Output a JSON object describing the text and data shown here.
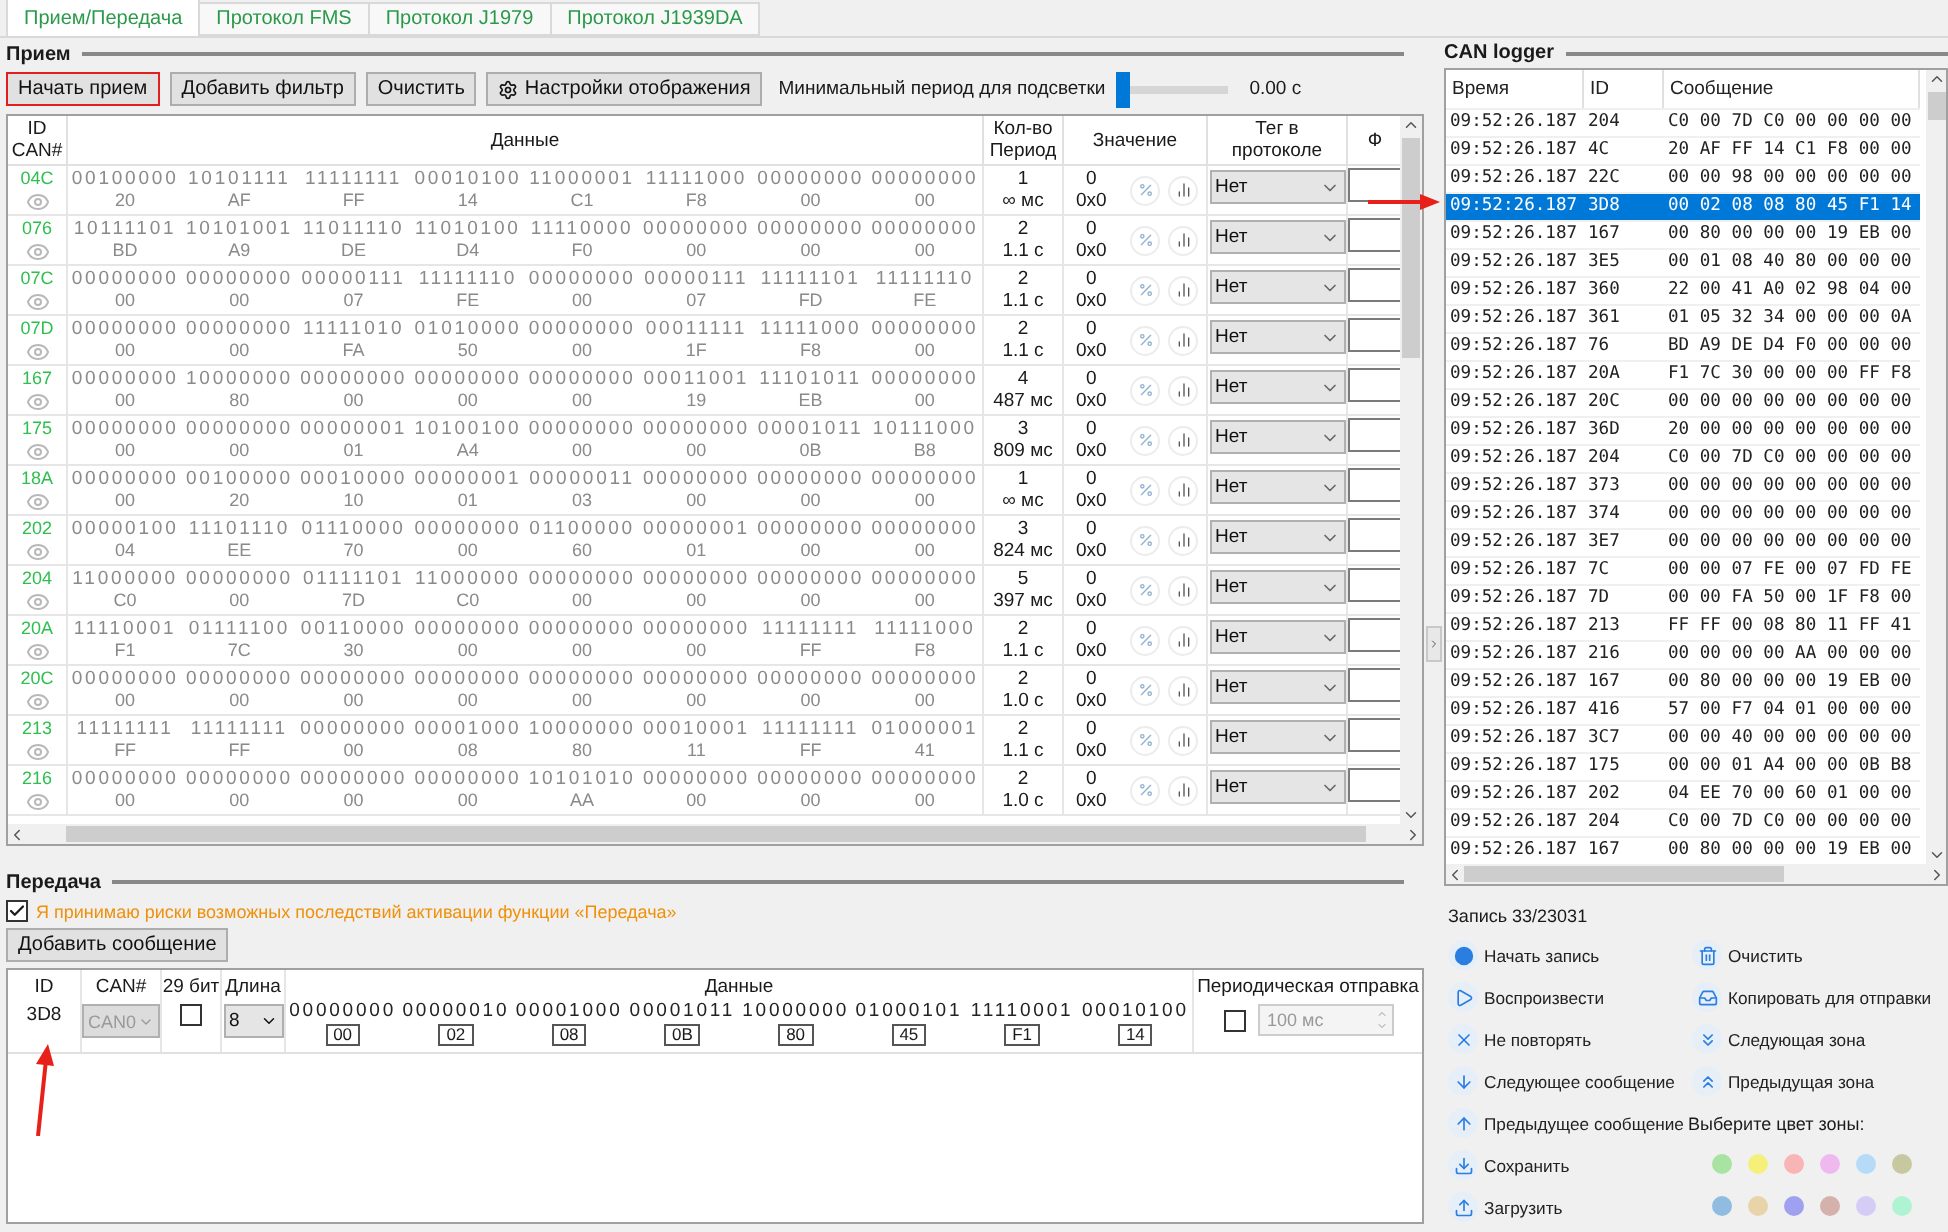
{
  "tabs": [
    {
      "label": "Прием/Передача",
      "selected": true
    },
    {
      "label": "Протокол FMS",
      "selected": false
    },
    {
      "label": "Протокол J1979",
      "selected": false
    },
    {
      "label": "Протокол J1939DA",
      "selected": false
    }
  ],
  "receive": {
    "title": "Прием",
    "toolbar": [
      {
        "label": "Начать прием",
        "highlighted": true,
        "kind": "plain"
      },
      {
        "label": "Добавить фильтр",
        "highlighted": false,
        "kind": "plain"
      },
      {
        "label": "Очистить",
        "highlighted": false,
        "kind": "plain"
      },
      {
        "label": "Настройки отображения",
        "highlighted": false,
        "kind": "settings"
      }
    ],
    "slider": {
      "label": "Минимальный период для подсветки",
      "level": 0,
      "reading": "0.00 с"
    },
    "columns": [
      "ID CAN#",
      "Данные",
      "Кол-во Период",
      "Значение",
      "Тег в протоколе",
      "Ф"
    ],
    "rows": [
      {
        "id": "04C",
        "bits": "00100000 10101111 11111111 00010100 11000001 11111000 00000000 00000000",
        "hex": "20 AF FF 14 C1 F8 00 00",
        "count": "1",
        "period": "∞ мс",
        "dec": "0",
        "hexval": "0x0",
        "tag": "Нет"
      },
      {
        "id": "076",
        "bits": "10111101 10101001 11011110 11010100 11110000 00000000 00000000 00000000",
        "hex": "BD A9 DE D4 F0 00 00 00",
        "count": "2",
        "period": "1.1 с",
        "dec": "0",
        "hexval": "0x0",
        "tag": "Нет"
      },
      {
        "id": "07C",
        "bits": "00000000 00000000 00000111 11111110 00000000 00000111 11111101 11111110",
        "hex": "00 00 07 FE 00 07 FD FE",
        "count": "2",
        "period": "1.1 с",
        "dec": "0",
        "hexval": "0x0",
        "tag": "Нет"
      },
      {
        "id": "07D",
        "bits": "00000000 00000000 11111010 01010000 00000000 00011111 11111000 00000000",
        "hex": "00 00 FA 50 00 1F F8 00",
        "count": "2",
        "period": "1.1 с",
        "dec": "0",
        "hexval": "0x0",
        "tag": "Нет"
      },
      {
        "id": "167",
        "bits": "00000000 10000000 00000000 00000000 00000000 00011001 11101011 00000000",
        "hex": "00 80 00 00 00 19 EB 00",
        "count": "4",
        "period": "487 мс",
        "dec": "0",
        "hexval": "0x0",
        "tag": "Нет"
      },
      {
        "id": "175",
        "bits": "00000000 00000000 00000001 10100100 00000000 00000000 00001011 10111000",
        "hex": "00 00 01 A4 00 00 0B B8",
        "count": "3",
        "period": "809 мс",
        "dec": "0",
        "hexval": "0x0",
        "tag": "Нет"
      },
      {
        "id": "18A",
        "bits": "00000000 00100000 00010000 00000001 00000011 00000000 00000000 00000000",
        "hex": "00 20 10 01 03 00 00 00",
        "count": "1",
        "period": "∞ мс",
        "dec": "0",
        "hexval": "0x0",
        "tag": "Нет"
      },
      {
        "id": "202",
        "bits": "00000100 11101110 01110000 00000000 01100000 00000001 00000000 00000000",
        "hex": "04 EE 70 00 60 01 00 00",
        "count": "3",
        "period": "824 мс",
        "dec": "0",
        "hexval": "0x0",
        "tag": "Нет"
      },
      {
        "id": "204",
        "bits": "11000000 00000000 01111101 11000000 00000000 00000000 00000000 00000000",
        "hex": "C0 00 7D C0 00 00 00 00",
        "count": "5",
        "period": "397 мс",
        "dec": "0",
        "hexval": "0x0",
        "tag": "Нет"
      },
      {
        "id": "20A",
        "bits": "11110001 01111100 00110000 00000000 00000000 00000000 11111111 11111000",
        "hex": "F1 7C 30 00 00 00 FF F8",
        "count": "2",
        "period": "1.1 с",
        "dec": "0",
        "hexval": "0x0",
        "tag": "Нет"
      },
      {
        "id": "20C",
        "bits": "00000000 00000000 00000000 00000000 00000000 00000000 00000000 00000000",
        "hex": "00 00 00 00 00 00 00 00",
        "count": "2",
        "period": "1.0 с",
        "dec": "0",
        "hexval": "0x0",
        "tag": "Нет"
      },
      {
        "id": "213",
        "bits": "11111111 11111111 00000000 00001000 10000000 00010001 11111111 01000001",
        "hex": "FF FF 00 08 80 11 FF 41",
        "count": "2",
        "period": "1.1 с",
        "dec": "0",
        "hexval": "0x0",
        "tag": "Нет"
      },
      {
        "id": "216",
        "bits": "00000000 00000000 00000000 00000000 10101010 00000000 00000000 00000000",
        "hex": "00 00 00 00 AA 00 00 00",
        "count": "2",
        "period": "1.0 с",
        "dec": "0",
        "hexval": "0x0",
        "tag": "Нет"
      }
    ]
  },
  "transmit": {
    "title": "Передача",
    "consent": {
      "label": "Я принимаю риски возможных последствий активации функции «Передача»",
      "checked": true
    },
    "add_button": "Добавить сообщение",
    "columns": [
      "ID",
      "CAN#",
      "29 бит",
      "Длина",
      "Данные",
      "Периодическая отправка"
    ],
    "row": {
      "id": "3D8",
      "can": {
        "value": "CAN0",
        "disabled": true
      },
      "ext29": {
        "checked": false
      },
      "length": "8",
      "bits": "00000000 00000010 00001000 00001011 10000000 01000101 11110001 00010100",
      "hex": "00 02 08 0B 80 45 F1 14",
      "periodic": {
        "checked": false
      },
      "interval": {
        "value": "100 мс",
        "disabled": true
      }
    }
  },
  "logger": {
    "title": "CAN logger",
    "columns": [
      "Время",
      "ID",
      "Сообщение"
    ],
    "rows": [
      {
        "time": "09:52:26.187",
        "id": "204",
        "msg": "C0 00 7D C0 00 00 00 00",
        "selected": false
      },
      {
        "time": "09:52:26.187",
        "id": "4C",
        "msg": "20 AF FF 14 C1 F8 00 00",
        "selected": false
      },
      {
        "time": "09:52:26.187",
        "id": "22C",
        "msg": "00 00 98 00 00 00 00 00",
        "selected": false
      },
      {
        "time": "09:52:26.187",
        "id": "3D8",
        "msg": "00 02 08 08 80 45 F1 14",
        "selected": true
      },
      {
        "time": "09:52:26.187",
        "id": "167",
        "msg": "00 80 00 00 00 19 EB 00",
        "selected": false
      },
      {
        "time": "09:52:26.187",
        "id": "3E5",
        "msg": "00 01 08 40 80 00 00 00",
        "selected": false
      },
      {
        "time": "09:52:26.187",
        "id": "360",
        "msg": "22 00 41 A0 02 98 04 00",
        "selected": false
      },
      {
        "time": "09:52:26.187",
        "id": "361",
        "msg": "01 05 32 34 00 00 00 0A",
        "selected": false
      },
      {
        "time": "09:52:26.187",
        "id": "76",
        "msg": "BD A9 DE D4 F0 00 00 00",
        "selected": false
      },
      {
        "time": "09:52:26.187",
        "id": "20A",
        "msg": "F1 7C 30 00 00 00 FF F8",
        "selected": false
      },
      {
        "time": "09:52:26.187",
        "id": "20C",
        "msg": "00 00 00 00 00 00 00 00",
        "selected": false
      },
      {
        "time": "09:52:26.187",
        "id": "36D",
        "msg": "20 00 00 00 00 00 00 00",
        "selected": false
      },
      {
        "time": "09:52:26.187",
        "id": "204",
        "msg": "C0 00 7D C0 00 00 00 00",
        "selected": false
      },
      {
        "time": "09:52:26.187",
        "id": "373",
        "msg": "00 00 00 00 00 00 00 00",
        "selected": false
      },
      {
        "time": "09:52:26.187",
        "id": "374",
        "msg": "00 00 00 00 00 00 00 00",
        "selected": false
      },
      {
        "time": "09:52:26.187",
        "id": "3E7",
        "msg": "00 00 00 00 00 00 00 00",
        "selected": false
      },
      {
        "time": "09:52:26.187",
        "id": "7C",
        "msg": "00 00 07 FE 00 07 FD FE",
        "selected": false
      },
      {
        "time": "09:52:26.187",
        "id": "7D",
        "msg": "00 00 FA 50 00 1F F8 00",
        "selected": false
      },
      {
        "time": "09:52:26.187",
        "id": "213",
        "msg": "FF FF 00 08 80 11 FF 41",
        "selected": false
      },
      {
        "time": "09:52:26.187",
        "id": "216",
        "msg": "00 00 00 00 AA 00 00 00",
        "selected": false
      },
      {
        "time": "09:52:26.187",
        "id": "167",
        "msg": "00 80 00 00 00 19 EB 00",
        "selected": false
      },
      {
        "time": "09:52:26.187",
        "id": "416",
        "msg": "57 00 F7 04 01 00 00 00",
        "selected": false
      },
      {
        "time": "09:52:26.187",
        "id": "3C7",
        "msg": "00 00 40 00 00 00 00 00",
        "selected": false
      },
      {
        "time": "09:52:26.187",
        "id": "175",
        "msg": "00 00 01 A4 00 00 0B B8",
        "selected": false
      },
      {
        "time": "09:52:26.187",
        "id": "202",
        "msg": "04 EE 70 00 60 01 00 00",
        "selected": false
      },
      {
        "time": "09:52:26.187",
        "id": "204",
        "msg": "C0 00 7D C0 00 00 00 00",
        "selected": false
      },
      {
        "time": "09:52:26.187",
        "id": "167",
        "msg": "00 80 00 00 00 19 EB 00",
        "selected": false
      }
    ],
    "record": "Запись 33/23031",
    "actions_left": [
      {
        "kind": "record",
        "label": "Начать запись"
      },
      {
        "kind": "play",
        "label": "Воспроизвести"
      },
      {
        "kind": "norepeat",
        "label": "Не повторять"
      },
      {
        "kind": "next",
        "label": "Следующее сообщение"
      },
      {
        "kind": "prev",
        "label": "Предыдущее сообщение"
      },
      {
        "kind": "save",
        "label": "Сохранить"
      },
      {
        "kind": "load",
        "label": "Загрузить"
      }
    ],
    "actions_right": [
      {
        "kind": "clear",
        "label": "Очистить"
      },
      {
        "kind": "copy",
        "label": "Копировать для отправки"
      },
      {
        "kind": "nextzone",
        "label": "Следующая зона"
      },
      {
        "kind": "prevzone",
        "label": "Предыдущая зона"
      }
    ],
    "zone_label": "Выберите цвет зоны:",
    "zone_colors": [
      {
        "color": "#a8e3a2"
      },
      {
        "color": "#f5f07a"
      },
      {
        "color": "#f9b5b5"
      },
      {
        "color": "#efb9ef"
      },
      {
        "color": "#b5dbf8"
      },
      {
        "color": "#c8c8a0"
      },
      {
        "color": "#8fbce0"
      },
      {
        "color": "#e9d3a8"
      },
      {
        "color": "#a0a0f0"
      },
      {
        "color": "#d4b1ab"
      },
      {
        "color": "#d6cdf7"
      },
      {
        "color": "#aef4d3"
      }
    ]
  }
}
